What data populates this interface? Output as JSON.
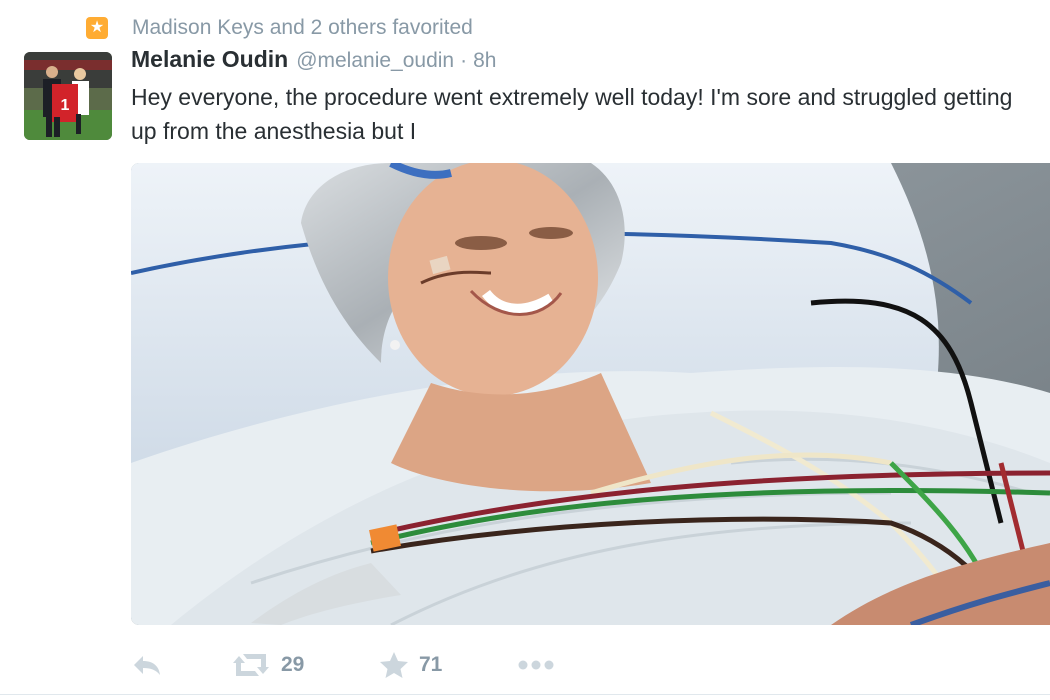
{
  "context": {
    "icon": "star-icon",
    "text": "Madison Keys and 2 others favorited",
    "badge_color": "#ffac33"
  },
  "tweet": {
    "fullname": "Melanie Oudin",
    "username": "@melanie_oudin",
    "separator": "·",
    "time": "8h",
    "text": "Hey everyone, the procedure went extremely well today! I'm sore and struggled getting up from the anesthesia but I"
  },
  "avatar": {
    "jersey_number": "1"
  },
  "actions": {
    "reply": {
      "icon": "reply-icon"
    },
    "retweet": {
      "icon": "retweet-icon",
      "count": "29"
    },
    "favorite": {
      "icon": "star-icon",
      "count": "71"
    },
    "more": {
      "icon": "more-icon"
    }
  },
  "colors": {
    "text": "#292f33",
    "muted": "#8899a6",
    "icon": "#ccd6dd"
  }
}
